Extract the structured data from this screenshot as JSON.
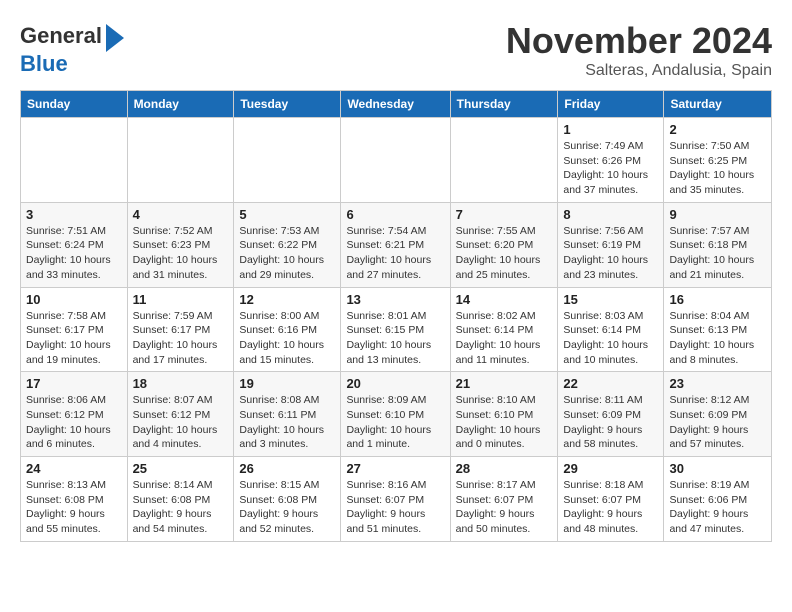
{
  "logo": {
    "line1": "General",
    "line2": "Blue"
  },
  "title": "November 2024",
  "location": "Salteras, Andalusia, Spain",
  "days_of_week": [
    "Sunday",
    "Monday",
    "Tuesday",
    "Wednesday",
    "Thursday",
    "Friday",
    "Saturday"
  ],
  "weeks": [
    [
      {
        "day": "",
        "info": ""
      },
      {
        "day": "",
        "info": ""
      },
      {
        "day": "",
        "info": ""
      },
      {
        "day": "",
        "info": ""
      },
      {
        "day": "",
        "info": ""
      },
      {
        "day": "1",
        "info": "Sunrise: 7:49 AM\nSunset: 6:26 PM\nDaylight: 10 hours and 37 minutes."
      },
      {
        "day": "2",
        "info": "Sunrise: 7:50 AM\nSunset: 6:25 PM\nDaylight: 10 hours and 35 minutes."
      }
    ],
    [
      {
        "day": "3",
        "info": "Sunrise: 7:51 AM\nSunset: 6:24 PM\nDaylight: 10 hours and 33 minutes."
      },
      {
        "day": "4",
        "info": "Sunrise: 7:52 AM\nSunset: 6:23 PM\nDaylight: 10 hours and 31 minutes."
      },
      {
        "day": "5",
        "info": "Sunrise: 7:53 AM\nSunset: 6:22 PM\nDaylight: 10 hours and 29 minutes."
      },
      {
        "day": "6",
        "info": "Sunrise: 7:54 AM\nSunset: 6:21 PM\nDaylight: 10 hours and 27 minutes."
      },
      {
        "day": "7",
        "info": "Sunrise: 7:55 AM\nSunset: 6:20 PM\nDaylight: 10 hours and 25 minutes."
      },
      {
        "day": "8",
        "info": "Sunrise: 7:56 AM\nSunset: 6:19 PM\nDaylight: 10 hours and 23 minutes."
      },
      {
        "day": "9",
        "info": "Sunrise: 7:57 AM\nSunset: 6:18 PM\nDaylight: 10 hours and 21 minutes."
      }
    ],
    [
      {
        "day": "10",
        "info": "Sunrise: 7:58 AM\nSunset: 6:17 PM\nDaylight: 10 hours and 19 minutes."
      },
      {
        "day": "11",
        "info": "Sunrise: 7:59 AM\nSunset: 6:17 PM\nDaylight: 10 hours and 17 minutes."
      },
      {
        "day": "12",
        "info": "Sunrise: 8:00 AM\nSunset: 6:16 PM\nDaylight: 10 hours and 15 minutes."
      },
      {
        "day": "13",
        "info": "Sunrise: 8:01 AM\nSunset: 6:15 PM\nDaylight: 10 hours and 13 minutes."
      },
      {
        "day": "14",
        "info": "Sunrise: 8:02 AM\nSunset: 6:14 PM\nDaylight: 10 hours and 11 minutes."
      },
      {
        "day": "15",
        "info": "Sunrise: 8:03 AM\nSunset: 6:14 PM\nDaylight: 10 hours and 10 minutes."
      },
      {
        "day": "16",
        "info": "Sunrise: 8:04 AM\nSunset: 6:13 PM\nDaylight: 10 hours and 8 minutes."
      }
    ],
    [
      {
        "day": "17",
        "info": "Sunrise: 8:06 AM\nSunset: 6:12 PM\nDaylight: 10 hours and 6 minutes."
      },
      {
        "day": "18",
        "info": "Sunrise: 8:07 AM\nSunset: 6:12 PM\nDaylight: 10 hours and 4 minutes."
      },
      {
        "day": "19",
        "info": "Sunrise: 8:08 AM\nSunset: 6:11 PM\nDaylight: 10 hours and 3 minutes."
      },
      {
        "day": "20",
        "info": "Sunrise: 8:09 AM\nSunset: 6:10 PM\nDaylight: 10 hours and 1 minute."
      },
      {
        "day": "21",
        "info": "Sunrise: 8:10 AM\nSunset: 6:10 PM\nDaylight: 10 hours and 0 minutes."
      },
      {
        "day": "22",
        "info": "Sunrise: 8:11 AM\nSunset: 6:09 PM\nDaylight: 9 hours and 58 minutes."
      },
      {
        "day": "23",
        "info": "Sunrise: 8:12 AM\nSunset: 6:09 PM\nDaylight: 9 hours and 57 minutes."
      }
    ],
    [
      {
        "day": "24",
        "info": "Sunrise: 8:13 AM\nSunset: 6:08 PM\nDaylight: 9 hours and 55 minutes."
      },
      {
        "day": "25",
        "info": "Sunrise: 8:14 AM\nSunset: 6:08 PM\nDaylight: 9 hours and 54 minutes."
      },
      {
        "day": "26",
        "info": "Sunrise: 8:15 AM\nSunset: 6:08 PM\nDaylight: 9 hours and 52 minutes."
      },
      {
        "day": "27",
        "info": "Sunrise: 8:16 AM\nSunset: 6:07 PM\nDaylight: 9 hours and 51 minutes."
      },
      {
        "day": "28",
        "info": "Sunrise: 8:17 AM\nSunset: 6:07 PM\nDaylight: 9 hours and 50 minutes."
      },
      {
        "day": "29",
        "info": "Sunrise: 8:18 AM\nSunset: 6:07 PM\nDaylight: 9 hours and 48 minutes."
      },
      {
        "day": "30",
        "info": "Sunrise: 8:19 AM\nSunset: 6:06 PM\nDaylight: 9 hours and 47 minutes."
      }
    ]
  ]
}
